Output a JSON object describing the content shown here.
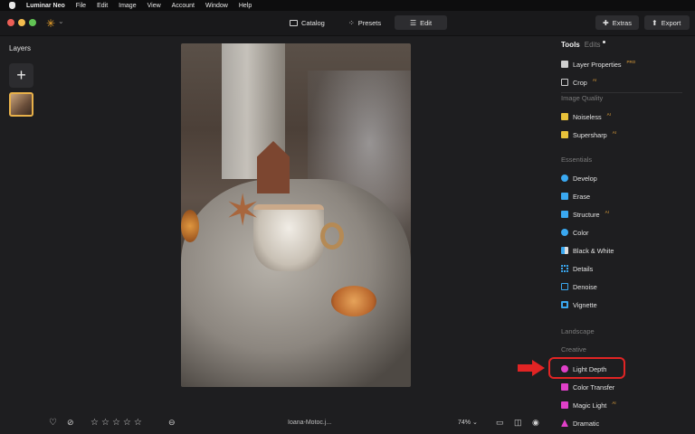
{
  "menubar": {
    "items": [
      "Luminar Neo",
      "File",
      "Edit",
      "Image",
      "View",
      "Account",
      "Window",
      "Help"
    ]
  },
  "topbar": {
    "tabs": {
      "catalog": "Catalog",
      "presets": "Presets",
      "edit": "Edit"
    },
    "extras_label": "Extras",
    "export_label": "Export"
  },
  "layers": {
    "title": "Layers",
    "add_label": "+"
  },
  "bottom": {
    "filename": "Ioana-Motoc.j...",
    "zoom": "74%",
    "zoom_chevron": "⌄"
  },
  "panel": {
    "tabs": {
      "tools": "Tools",
      "edits": "Edits"
    },
    "top_tools": [
      {
        "label": "Layer Properties",
        "badge": "PRO",
        "icon": "layers-icon"
      },
      {
        "label": "Crop",
        "badge": "AI",
        "icon": "crop-icon"
      }
    ],
    "sections": {
      "image_quality": "Image Quality",
      "essentials": "Essentials",
      "landscape": "Landscape",
      "creative": "Creative"
    },
    "image_quality_tools": [
      {
        "label": "Noiseless",
        "badge": "AI"
      },
      {
        "label": "Supersharp",
        "badge": "AI"
      }
    ],
    "essentials_tools": [
      {
        "label": "Develop"
      },
      {
        "label": "Erase"
      },
      {
        "label": "Structure",
        "badge": "AI"
      },
      {
        "label": "Color"
      },
      {
        "label": "Black & White"
      },
      {
        "label": "Details"
      },
      {
        "label": "Denoise"
      },
      {
        "label": "Vignette"
      }
    ],
    "creative_tools": [
      {
        "label": "Light Depth"
      },
      {
        "label": "Color Transfer"
      },
      {
        "label": "Magic Light",
        "badge": "AI"
      },
      {
        "label": "Dramatic"
      }
    ]
  },
  "colors": {
    "accent_highlight": "#e12424",
    "logo": "#f0a52a",
    "badge": "#e3a23b"
  }
}
